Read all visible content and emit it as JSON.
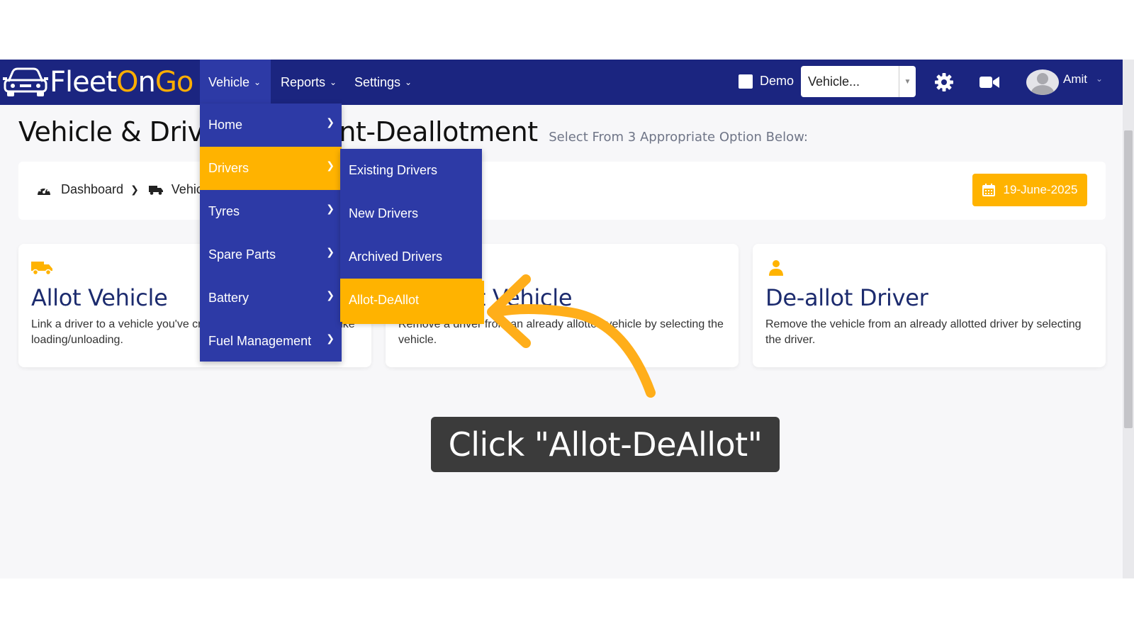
{
  "brand": {
    "name_part1": "Fleet",
    "name_o1": "O",
    "name_part2": "n",
    "name_o2": "G",
    "name_part3": "o"
  },
  "nav": {
    "vehicle": "Vehicle",
    "reports": "Reports",
    "settings": "Settings",
    "demo_label": "Demo",
    "vehicle_select": "Vehicle...",
    "user_name": "Amit"
  },
  "page": {
    "title": "Vehicle & Driver Allotment-Deallotment",
    "subtitle": "Select From 3 Appropriate Option Below:"
  },
  "breadcrumb": {
    "item1": "Dashboard",
    "item2": "Vehicle"
  },
  "date": "19-June-2025",
  "cards": [
    {
      "title": "Allot Vehicle",
      "desc": "Link a driver to a vehicle you've created to assign operations like loading/unloading."
    },
    {
      "title": "De-allot Vehicle",
      "desc": "Remove a driver from an already allotted vehicle by selecting the vehicle."
    },
    {
      "title": "De-allot Driver",
      "desc": "Remove the vehicle from an already allotted driver by selecting the driver."
    }
  ],
  "vehicle_menu": [
    {
      "label": "Home"
    },
    {
      "label": "Drivers"
    },
    {
      "label": "Tyres"
    },
    {
      "label": "Spare Parts"
    },
    {
      "label": "Battery"
    },
    {
      "label": "Fuel Management"
    }
  ],
  "drivers_submenu": [
    {
      "label": "Existing Drivers"
    },
    {
      "label": "New Drivers"
    },
    {
      "label": "Archived Drivers"
    },
    {
      "label": "Allot-DeAllot"
    }
  ],
  "callout": "Click \"Allot-DeAllot\"",
  "colors": {
    "navbar": "#1b2580",
    "menu": "#2d3aa6",
    "accent": "#ffb300",
    "card_title": "#1c2b6e"
  },
  "icons": [
    "car-logo-icon",
    "chevron-down-icon",
    "gear-icon",
    "video-camera-icon",
    "avatar-icon",
    "dashboard-gauge-icon",
    "truck-icon",
    "calendar-icon",
    "chevron-right-icon",
    "user-icon",
    "curved-arrow-icon"
  ]
}
